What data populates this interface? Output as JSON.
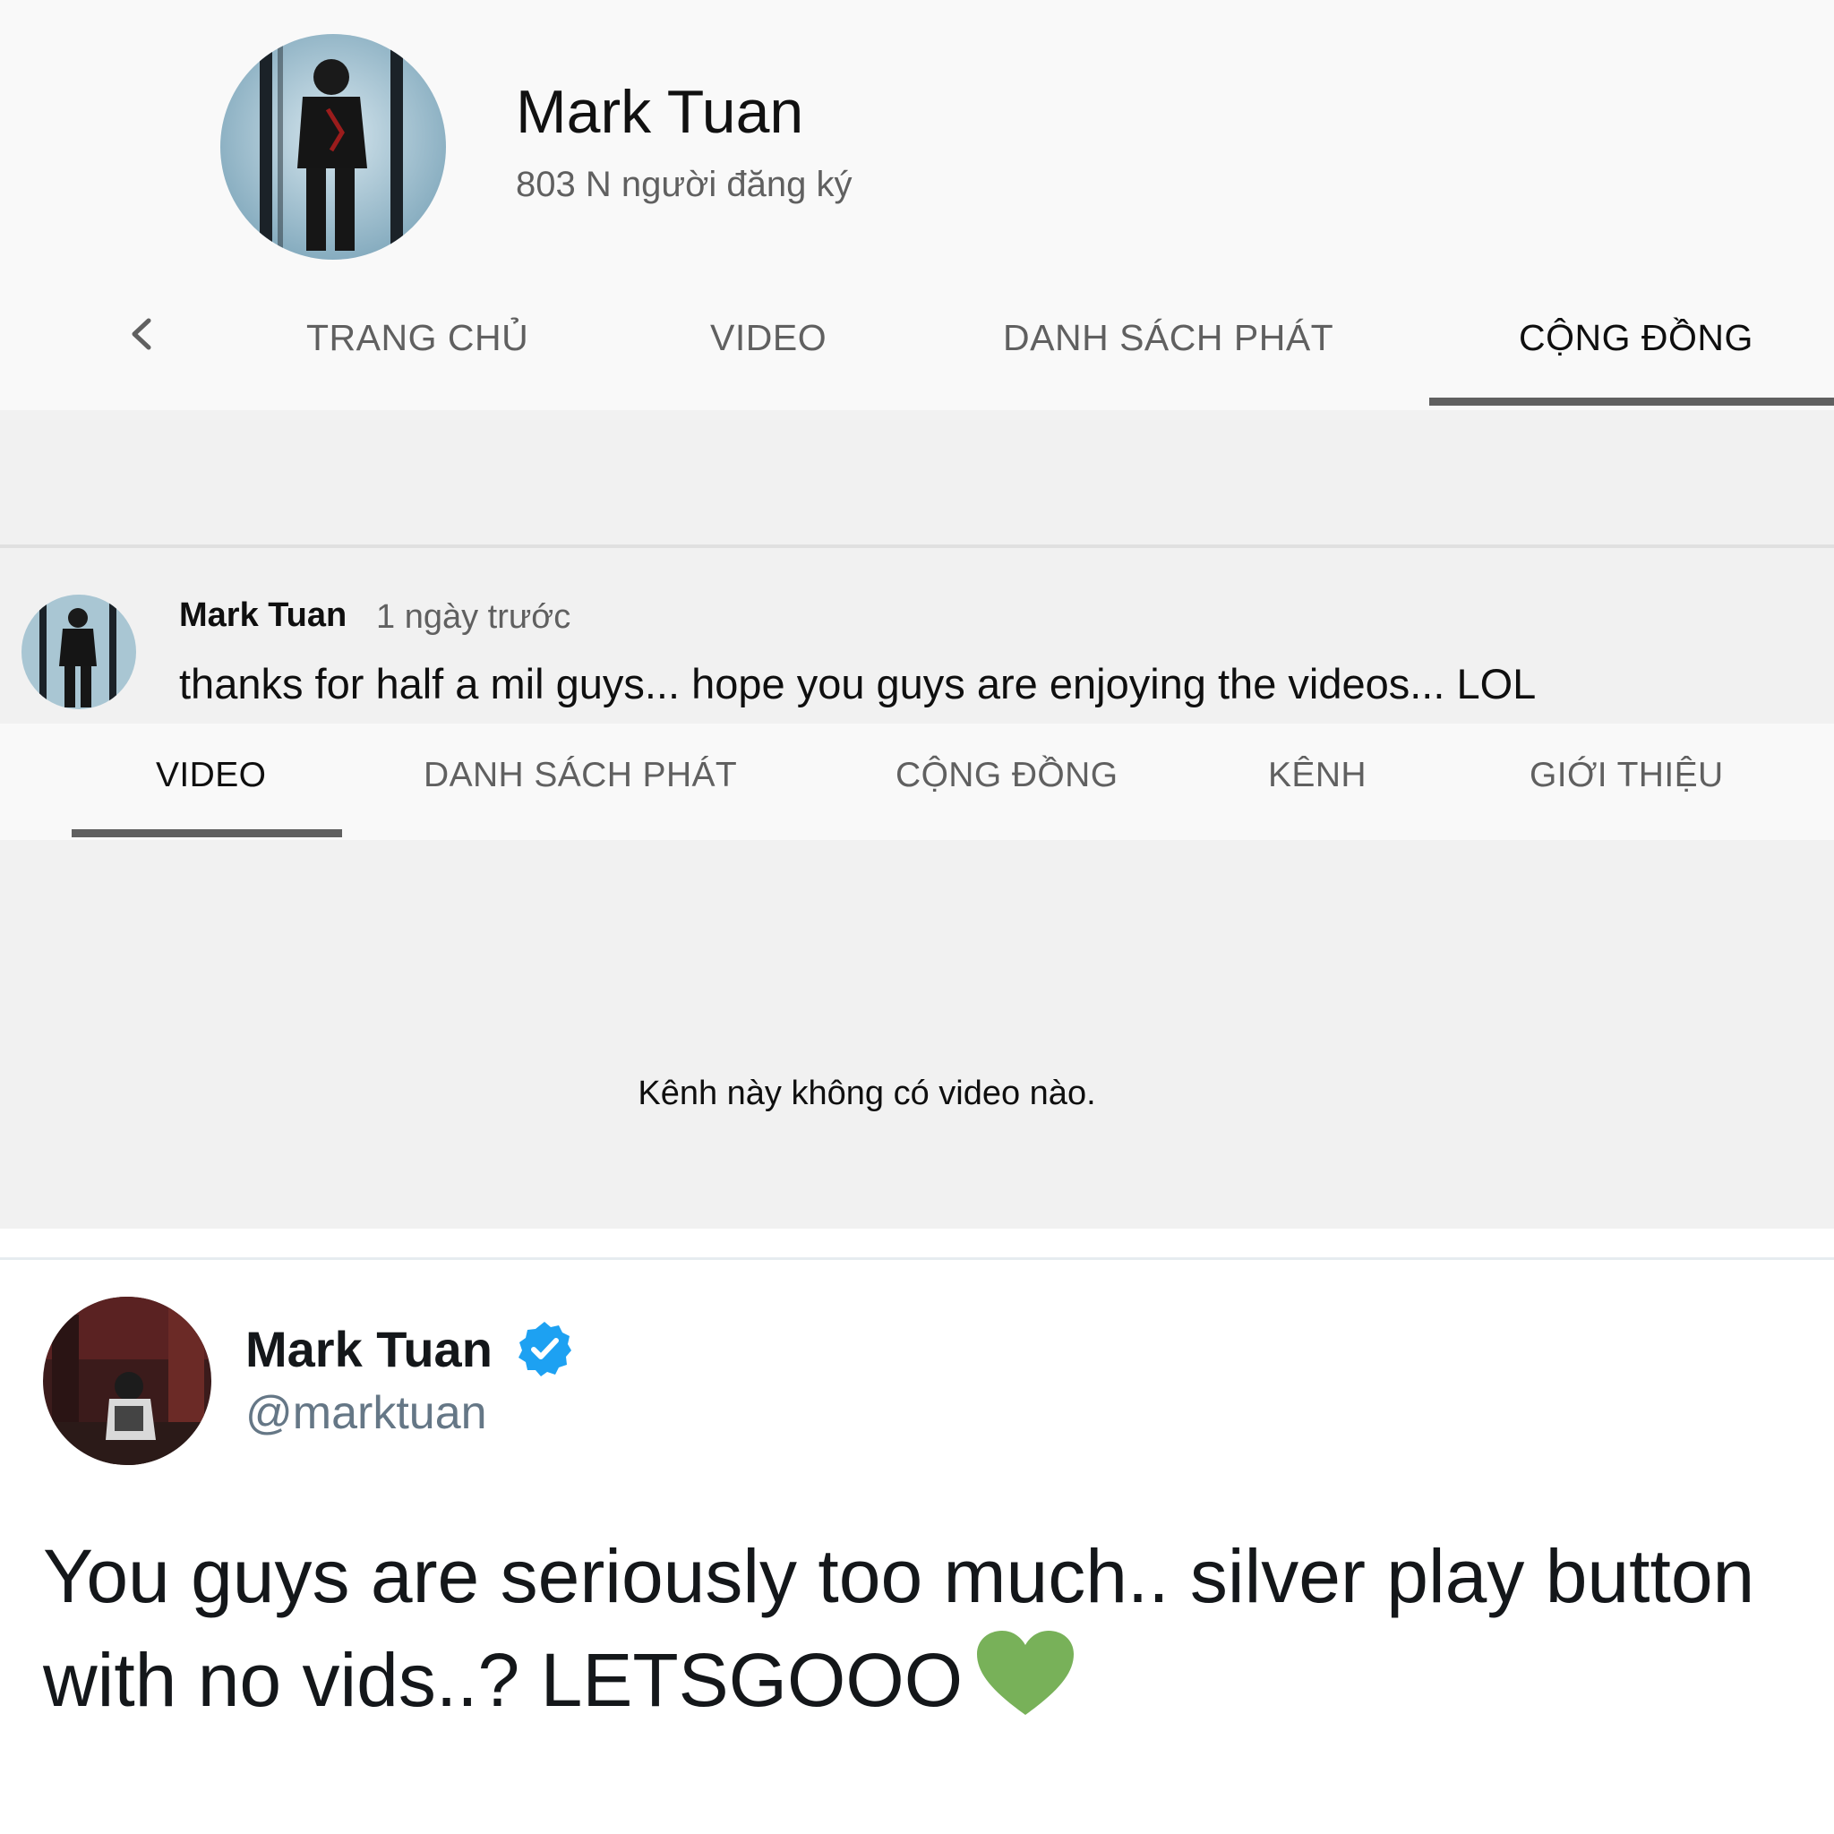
{
  "channel": {
    "name": "Mark Tuan",
    "subscribers": "803 N người đăng ký"
  },
  "channel_tabs": [
    {
      "label": "TRANG CHỦ",
      "active": false
    },
    {
      "label": "VIDEO",
      "active": false
    },
    {
      "label": "DANH SÁCH PHÁT",
      "active": false
    },
    {
      "label": "CỘNG ĐỒNG",
      "active": true
    }
  ],
  "community_post": {
    "author": "Mark Tuan",
    "time": "1 ngày trước",
    "text": "thanks for half a mil guys... hope you guys are enjoying the videos... LOL"
  },
  "secondary_tabs": [
    {
      "label": "VIDEO",
      "active": true
    },
    {
      "label": "DANH SÁCH PHÁT",
      "active": false
    },
    {
      "label": "CỘNG ĐỒNG",
      "active": false
    },
    {
      "label": "KÊNH",
      "active": false
    },
    {
      "label": "GIỚI THIỆU",
      "active": false
    }
  ],
  "empty_state": {
    "message": "Kênh này không có video nào."
  },
  "tweet": {
    "name": "Mark Tuan",
    "handle": "@marktuan",
    "verified": true,
    "text_line1": "You guys are seriously too much.. silver play button",
    "text_line2": "with no vids..? LETSGOOO",
    "emoji": "green-heart"
  },
  "colors": {
    "page_bg": "#f9f9f9",
    "section_gray": "#f1f1f1",
    "tab_underline": "#606060",
    "verified_blue": "#1da1f2",
    "heart_green": "#78b159"
  },
  "icons": {
    "back": "chevron-left-icon",
    "verified": "verified-badge-icon",
    "emoji": "green-heart-icon"
  }
}
